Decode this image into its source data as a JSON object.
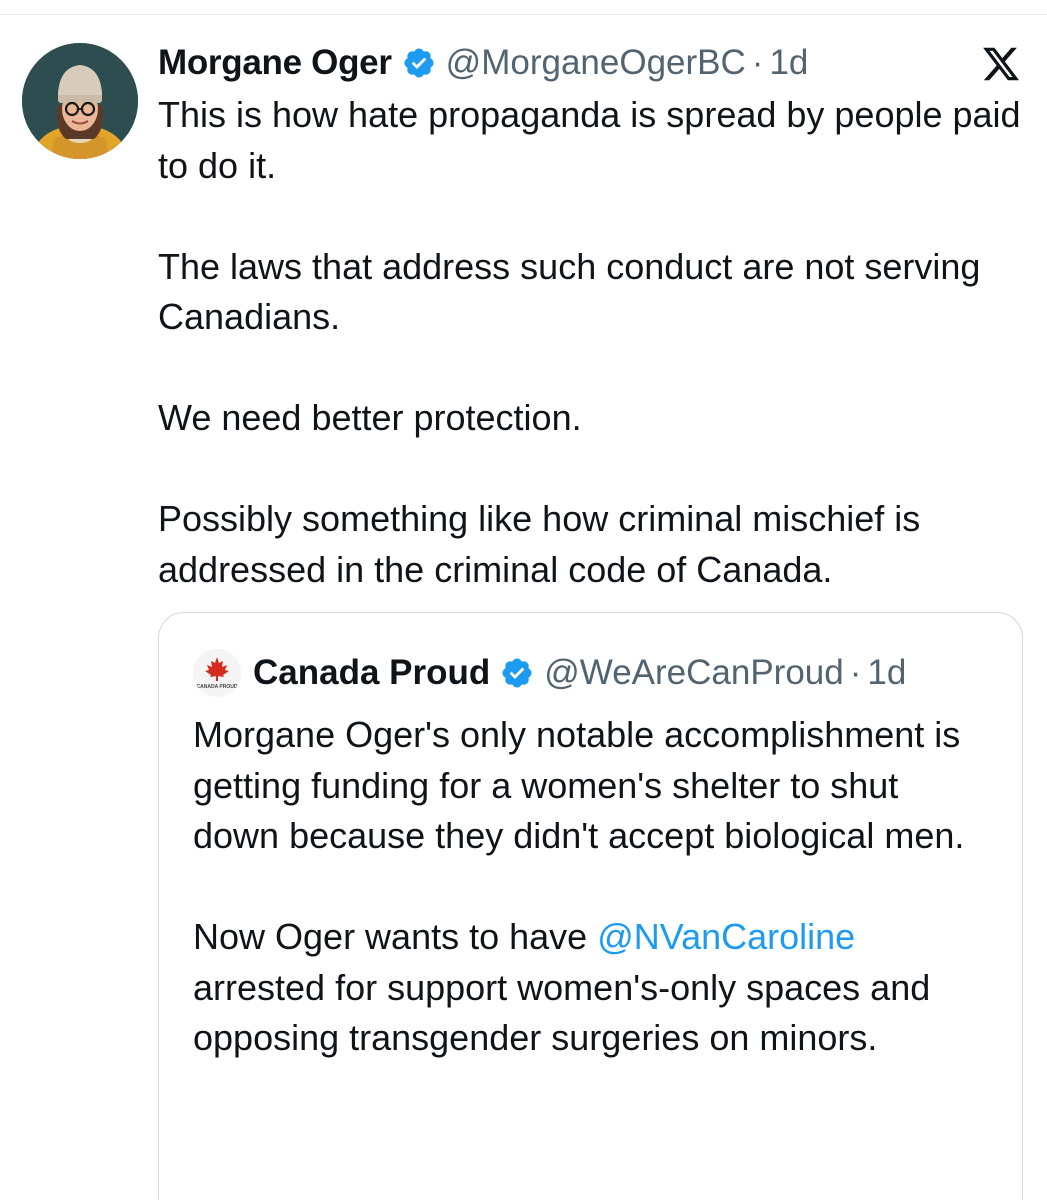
{
  "tweet": {
    "author_name": "Morgane Oger",
    "author_handle": "@MorganeOgerBC",
    "separator": "·",
    "time": "1d",
    "avatar_icon": "profile-photo-avatar",
    "verified_icon": "verified-badge-icon",
    "platform_icon": "x-logo-icon",
    "paragraphs": [
      "This is how hate propaganda is spread by people paid to do it.",
      "The laws that address such conduct are not serving Canadians.",
      "We need better protection.",
      "Possibly something like how criminal mischief is addressed in the criminal code of Canada."
    ]
  },
  "quote": {
    "author_name": "Canada Proud",
    "author_handle": "@WeAreCanProud",
    "separator": "·",
    "time": "1d",
    "avatar_logo_text": "CANADA PROUD",
    "paragraph1": "Morgane Oger's only notable accomplishment is getting funding for a women's shelter to shut down because they didn't accept biological men.",
    "paragraph2_before": "Now Oger wants to have ",
    "paragraph2_mention": "@NVanCaroline",
    "paragraph2_after": " arrested for support women's-only spaces and opposing transgender surgeries on minors."
  },
  "colors": {
    "text": "#0f1419",
    "secondary": "#536471",
    "link": "#1d9bf0",
    "verified": "#1d9bf0",
    "border": "#cfd9de"
  }
}
